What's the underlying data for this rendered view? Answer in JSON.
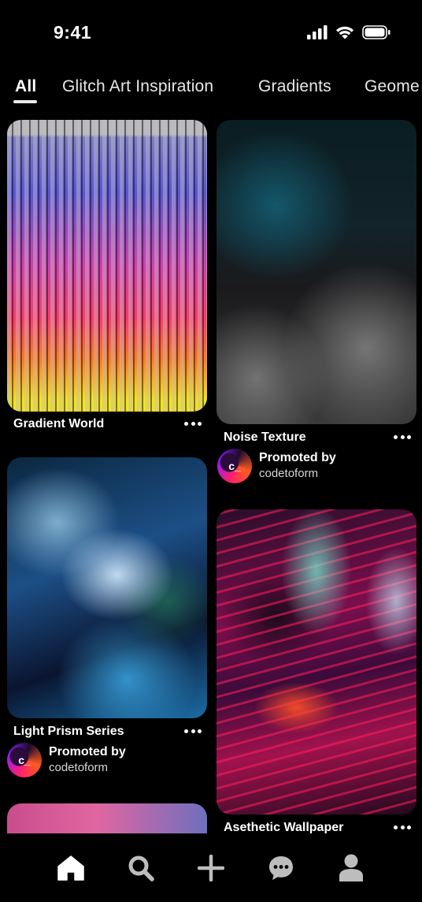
{
  "status_bar": {
    "time": "9:41",
    "icons": [
      "cellular-signal-icon",
      "wifi-icon",
      "battery-icon"
    ]
  },
  "tabs": [
    {
      "label": "All",
      "active": true
    },
    {
      "label": "Glitch Art Inspiration",
      "active": false
    },
    {
      "label": "Gradients",
      "active": false
    },
    {
      "label": "Geome",
      "active": false
    }
  ],
  "pins": {
    "gradient_world": {
      "title": "Gradient World"
    },
    "noise_texture": {
      "title": "Noise Texture",
      "promoted_label": "Promoted by",
      "promoter": "codetoform",
      "avatar_text": "c_"
    },
    "light_prism": {
      "title": "Light Prism Series",
      "promoted_label": "Promoted by",
      "promoter": "codetoform",
      "avatar_text": "c_"
    },
    "asethetic_wallpaper": {
      "title": "Asethetic Wallpaper"
    }
  },
  "bottom_nav": [
    "home-icon",
    "search-icon",
    "plus-icon",
    "message-icon",
    "profile-icon"
  ],
  "colors": {
    "background": "#000000",
    "text": "#ffffff"
  }
}
